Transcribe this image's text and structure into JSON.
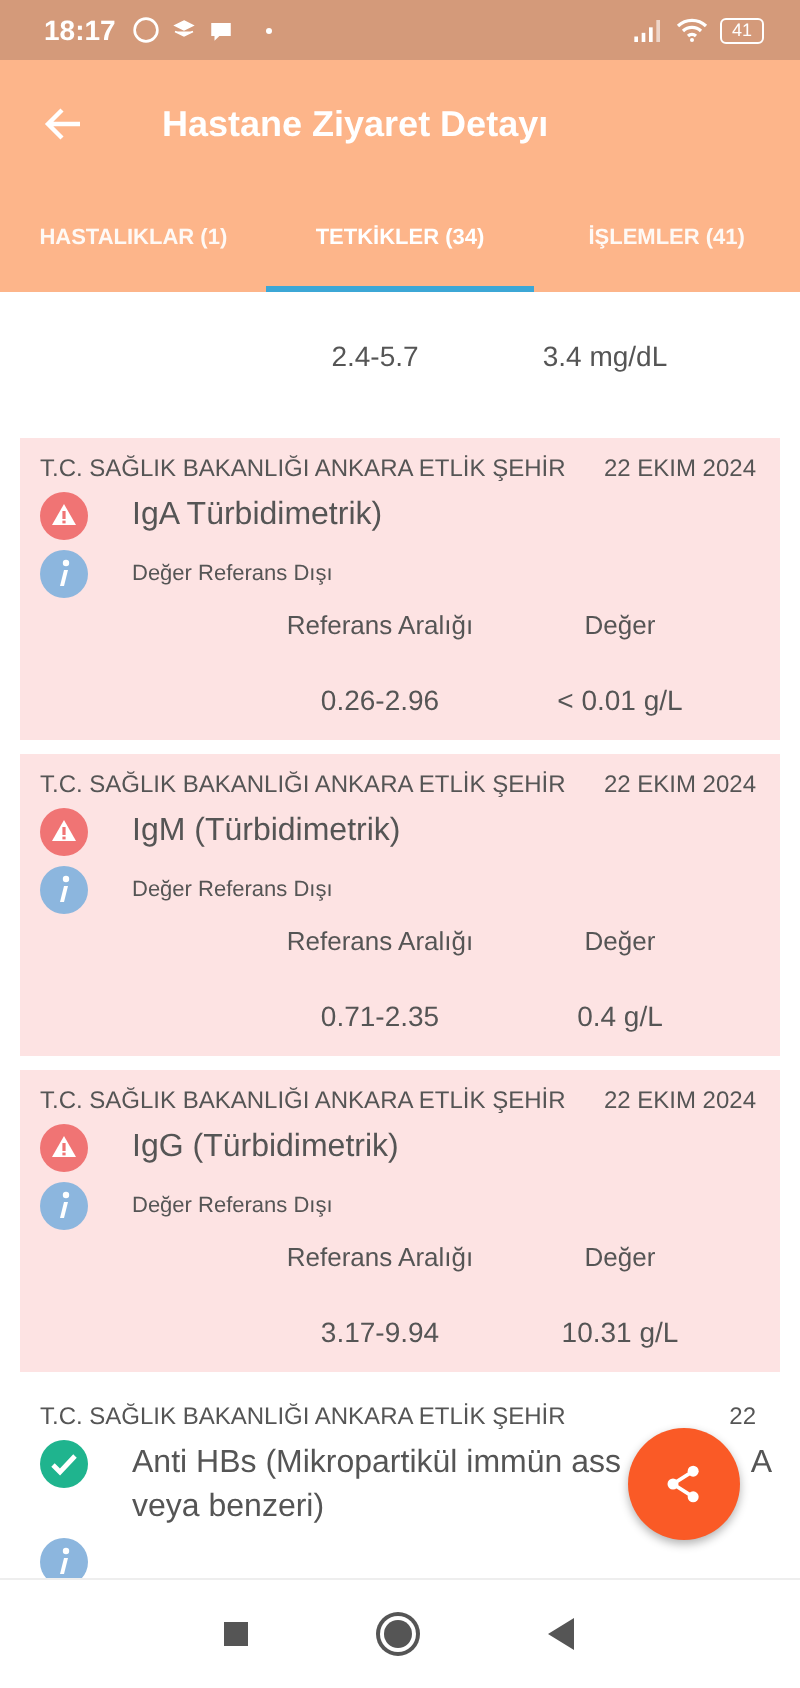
{
  "status_bar": {
    "time": "18:17",
    "battery": "41"
  },
  "app_bar": {
    "title": "Hastane Ziyaret Detayı"
  },
  "tabs": [
    {
      "label": "HASTALIKLAR (1)",
      "selected": false
    },
    {
      "label": "TETKİKLER (34)",
      "selected": true
    },
    {
      "label": "İŞLEMLER (41)",
      "selected": false
    }
  ],
  "partial_result": {
    "range": "2.4-5.7",
    "value": "3.4 mg/dL"
  },
  "results": [
    {
      "abnormal": true,
      "hospital": "T.C. SAĞLIK BAKANLIĞI ANKARA ETLİK ŞEHİR",
      "date": "22 EKIM 2024",
      "test": "IgA Türbidimetrik)",
      "note": "Değer Referans Dışı",
      "range_label": "Referans Aralığı",
      "value_label": "Değer",
      "range": "0.26-2.96",
      "value": "< 0.01 g/L"
    },
    {
      "abnormal": true,
      "hospital": "T.C. SAĞLIK BAKANLIĞI ANKARA ETLİK ŞEHİR",
      "date": "22 EKIM 2024",
      "test": "IgM (Türbidimetrik)",
      "note": "Değer Referans Dışı",
      "range_label": "Referans Aralığı",
      "value_label": "Değer",
      "range": "0.71-2.35",
      "value": "0.4 g/L"
    },
    {
      "abnormal": true,
      "hospital": "T.C. SAĞLIK BAKANLIĞI ANKARA ETLİK ŞEHİR",
      "date": "22 EKIM 2024",
      "test": "IgG (Türbidimetrik)",
      "note": "Değer Referans Dışı",
      "range_label": "Referans Aralığı",
      "value_label": "Değer",
      "range": "3.17-9.94",
      "value": "10.31 g/L"
    },
    {
      "abnormal": false,
      "hospital": "T.C. SAĞLIK BAKANLIĞI ANKARA ETLİK ŞEHİR",
      "date": "22",
      "test": "Anti HBs  (Mikropartikül immün ass",
      "test_fragment": "A",
      "test_line2": "veya benzeri)"
    }
  ]
}
